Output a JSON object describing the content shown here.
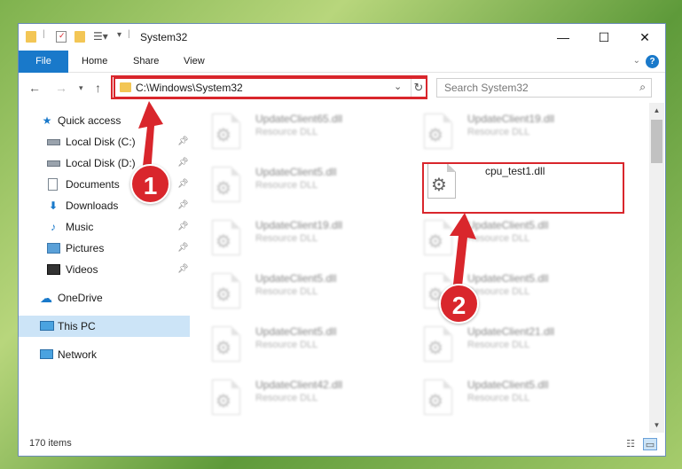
{
  "window": {
    "title": "System32",
    "minimize": "—",
    "maximize": "☐",
    "close": "✕"
  },
  "ribbon": {
    "tabs": [
      "File",
      "Home",
      "Share",
      "View"
    ],
    "help": "?"
  },
  "address": {
    "path": "C:\\Windows\\System32",
    "search_placeholder": "Search System32"
  },
  "sidebar": {
    "items": [
      {
        "label": "Quick access",
        "icon": "star-icon",
        "pinned": false,
        "selected": false
      },
      {
        "label": "Local Disk (C:)",
        "icon": "drive-icon",
        "pinned": true,
        "selected": false
      },
      {
        "label": "Local Disk (D:)",
        "icon": "drive-icon",
        "pinned": true,
        "selected": false
      },
      {
        "label": "Documents",
        "icon": "documents-icon",
        "pinned": true,
        "selected": false
      },
      {
        "label": "Downloads",
        "icon": "download-icon",
        "pinned": true,
        "selected": false
      },
      {
        "label": "Music",
        "icon": "music-icon",
        "pinned": true,
        "selected": false
      },
      {
        "label": "Pictures",
        "icon": "pictures-icon",
        "pinned": true,
        "selected": false
      },
      {
        "label": "Videos",
        "icon": "videos-icon",
        "pinned": true,
        "selected": false
      },
      {
        "label": "OneDrive",
        "icon": "cloud-icon",
        "pinned": false,
        "selected": false
      },
      {
        "label": "This PC",
        "icon": "computer-icon",
        "pinned": false,
        "selected": true
      },
      {
        "label": "Network",
        "icon": "network-icon",
        "pinned": false,
        "selected": false
      }
    ]
  },
  "files": {
    "left_column": [
      {
        "name": "UpdateClient65.dll",
        "type": "Resource DLL"
      },
      {
        "name": "UpdateClient5.dll",
        "type": "Resource DLL"
      },
      {
        "name": "UpdateClient19.dll",
        "type": "Resource DLL"
      },
      {
        "name": "UpdateClient5.dll",
        "type": "Resource DLL"
      },
      {
        "name": "UpdateClient5.dll",
        "type": "Resource DLL"
      },
      {
        "name": "UpdateClient42.dll",
        "type": "Resource DLL"
      }
    ],
    "right_column": [
      {
        "name": "UpdateClient19.dll",
        "type": "Resource DLL"
      },
      {
        "name": "cpu_test1.dll",
        "type": ""
      },
      {
        "name": "UpdateClient5.dll",
        "type": "Resource DLL"
      },
      {
        "name": "UpdateClient5.dll",
        "type": "Resource DLL"
      },
      {
        "name": "UpdateClient21.dll",
        "type": "Resource DLL"
      },
      {
        "name": "UpdateClient5.dll",
        "type": "Resource DLL"
      }
    ]
  },
  "status": {
    "item_count": "170 items"
  },
  "annotations": {
    "step1": "1",
    "step2": "2",
    "accent_color": "#d9262c"
  }
}
